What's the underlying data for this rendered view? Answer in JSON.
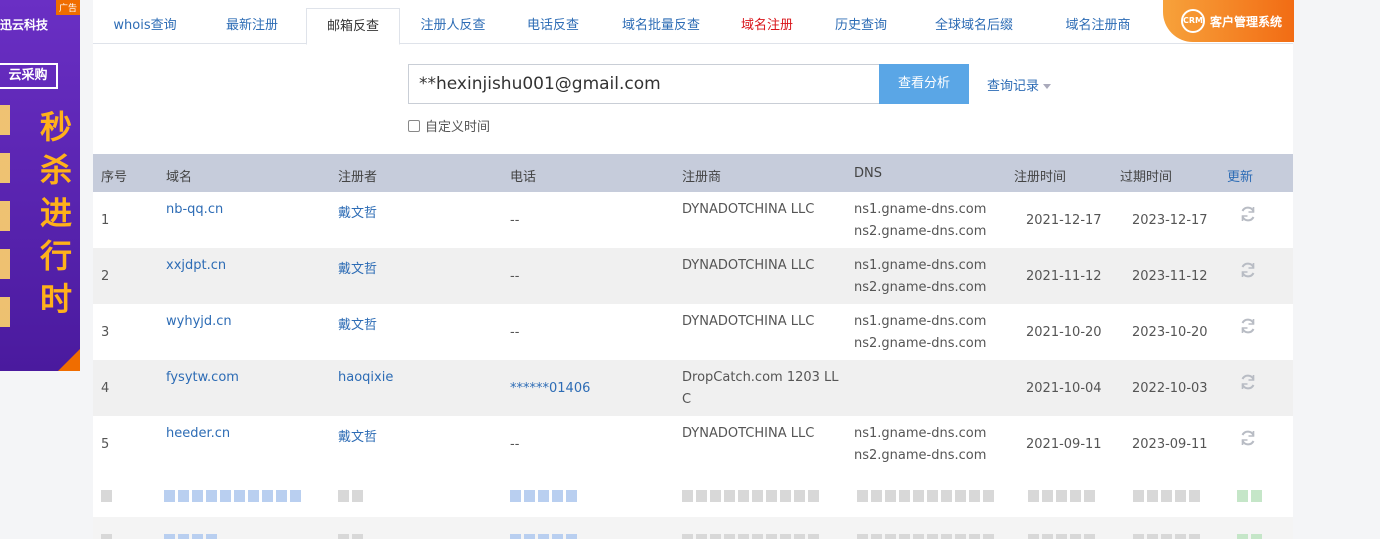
{
  "ad": {
    "tag": "广告",
    "brand": "迅云科技",
    "buy_label": "云采购",
    "slogan_chars": [
      "秒",
      "杀",
      "进",
      "行",
      "时"
    ]
  },
  "tabs": [
    {
      "label": "whois查询",
      "active": false
    },
    {
      "label": "最新注册",
      "active": false
    },
    {
      "label": "邮箱反查",
      "active": true
    },
    {
      "label": "注册人反查",
      "active": false
    },
    {
      "label": "电话反查",
      "active": false
    },
    {
      "label": "域名批量反查",
      "active": false
    },
    {
      "label": "域名注册",
      "active": false,
      "color": "#d9141a"
    },
    {
      "label": "历史查询",
      "active": false
    },
    {
      "label": "全球域名后缀",
      "active": false
    },
    {
      "label": "域名注册商",
      "active": false
    }
  ],
  "crm": {
    "logo": "CRM",
    "label": "客户管理系统"
  },
  "search": {
    "value": "**hexinjishu001@gmail.com",
    "button": "查看分析",
    "history": "查询记录",
    "custom_time": "自定义时间"
  },
  "table": {
    "headers": [
      "序号",
      "域名",
      "注册者",
      "电话",
      "注册商",
      "DNS",
      "注册时间",
      "过期时间",
      "更新"
    ],
    "rows": [
      {
        "no": "1",
        "domain": "nb-qq.cn",
        "registrant": "戴文哲",
        "phone": "--",
        "registrar": "DYNADOTCHINA LLC",
        "registrar2": "",
        "dns1": "ns1.gname-dns.com",
        "dns2": "ns2.gname-dns.com",
        "reg_date": "2021-12-17",
        "exp_date": "2023-12-17"
      },
      {
        "no": "2",
        "domain": "xxjdpt.cn",
        "registrant": "戴文哲",
        "phone": "--",
        "registrar": "DYNADOTCHINA LLC",
        "registrar2": "",
        "dns1": "ns1.gname-dns.com",
        "dns2": "ns2.gname-dns.com",
        "reg_date": "2021-11-12",
        "exp_date": "2023-11-12"
      },
      {
        "no": "3",
        "domain": "wyhyjd.cn",
        "registrant": "戴文哲",
        "phone": "--",
        "registrar": "DYNADOTCHINA LLC",
        "registrar2": "",
        "dns1": "ns1.gname-dns.com",
        "dns2": "ns2.gname-dns.com",
        "reg_date": "2021-10-20",
        "exp_date": "2023-10-20"
      },
      {
        "no": "4",
        "domain": "fysytw.com",
        "registrant": "haoqixie",
        "phone": "******01406",
        "registrar": "DropCatch.com 1203 LL",
        "registrar2": "C",
        "dns1": "",
        "dns2": "",
        "reg_date": "2021-10-04",
        "exp_date": "2022-10-03"
      },
      {
        "no": "5",
        "domain": "heeder.cn",
        "registrant": "戴文哲",
        "phone": "--",
        "registrar": "DYNADOTCHINA LLC",
        "registrar2": "",
        "dns1": "ns1.gname-dns.com",
        "dns2": "ns2.gname-dns.com",
        "reg_date": "2021-09-11",
        "exp_date": "2023-09-11"
      }
    ]
  }
}
